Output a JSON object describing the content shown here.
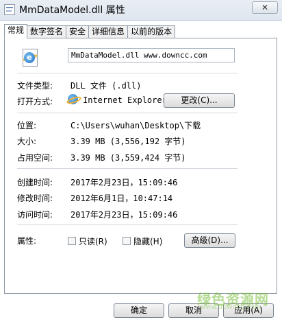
{
  "window": {
    "title": "MmDataModel.dll 属性",
    "close_label": "✕"
  },
  "tabs": [
    {
      "label": "常规",
      "active": true
    },
    {
      "label": "数字签名",
      "active": false
    },
    {
      "label": "安全",
      "active": false
    },
    {
      "label": "详细信息",
      "active": false
    },
    {
      "label": "以前的版本",
      "active": false
    }
  ],
  "general": {
    "file_name": "MmDataModel.dll  www.downcc.com",
    "type_label": "文件类型:",
    "type_value": "DLL 文件 (.dll)",
    "opens_with_label": "打开方式:",
    "opens_with_value": "Internet Explorer",
    "change_button": "更改(C)...",
    "location_label": "位置:",
    "location_value": "C:\\Users\\wuhan\\Desktop\\下载",
    "size_label": "大小:",
    "size_value": "3.39 MB (3,556,192 字节)",
    "size_on_disk_label": "占用空间:",
    "size_on_disk_value": "3.39 MB (3,559,424 字节)",
    "created_label": "创建时间:",
    "created_value": "2017年2月23日，15:09:46",
    "modified_label": "修改时间:",
    "modified_value": "2012年6月1日，10:47:14",
    "accessed_label": "访问时间:",
    "accessed_value": "2017年2月23日，15:09:46",
    "attributes_label": "属性:",
    "readonly_label": "只读(R)",
    "hidden_label": "隐藏(H)",
    "advanced_button": "高级(D)..."
  },
  "footer": {
    "ok_button": "确定",
    "cancel_button": "取消",
    "apply_button": "应用(A)"
  },
  "watermark": {
    "text": "绿色资源网",
    "url": "www.downcc.com"
  }
}
